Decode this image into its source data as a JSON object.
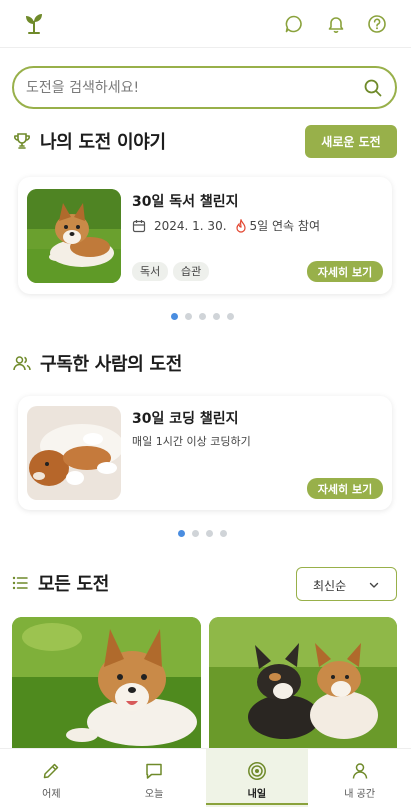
{
  "search": {
    "placeholder": "도전을 검색하세요!"
  },
  "my_challenges": {
    "title": "나의 도전 이야기",
    "new_button": "새로운 도전",
    "card": {
      "title": "30일 독서 챌린지",
      "date": "2024. 1. 30.",
      "streak": "5일 연속 참여",
      "tags": [
        "독서",
        "습관"
      ],
      "detail_button": "자세히 보기"
    },
    "page_count": 5,
    "active_page": 1
  },
  "subscribed": {
    "title": "구독한 사람의 도전",
    "card": {
      "title": "30일 코딩 챌린지",
      "description": "매일 1시간 이상 코딩하기",
      "detail_button": "자세히 보기"
    },
    "page_count": 4,
    "active_page": 1
  },
  "all_challenges": {
    "title": "모든 도전",
    "sort_selected": "최신순"
  },
  "nav": {
    "items": [
      {
        "label": "어제",
        "icon": "pencil-icon"
      },
      {
        "label": "오늘",
        "icon": "chat-square-icon"
      },
      {
        "label": "내일",
        "icon": "target-icon",
        "active": true
      },
      {
        "label": "내 공간",
        "icon": "user-icon"
      }
    ]
  },
  "colors": {
    "accent": "#98b04a",
    "accent_dark": "#6f8a2a",
    "dot_active": "#4a8de0",
    "flame": "#e2452f"
  }
}
